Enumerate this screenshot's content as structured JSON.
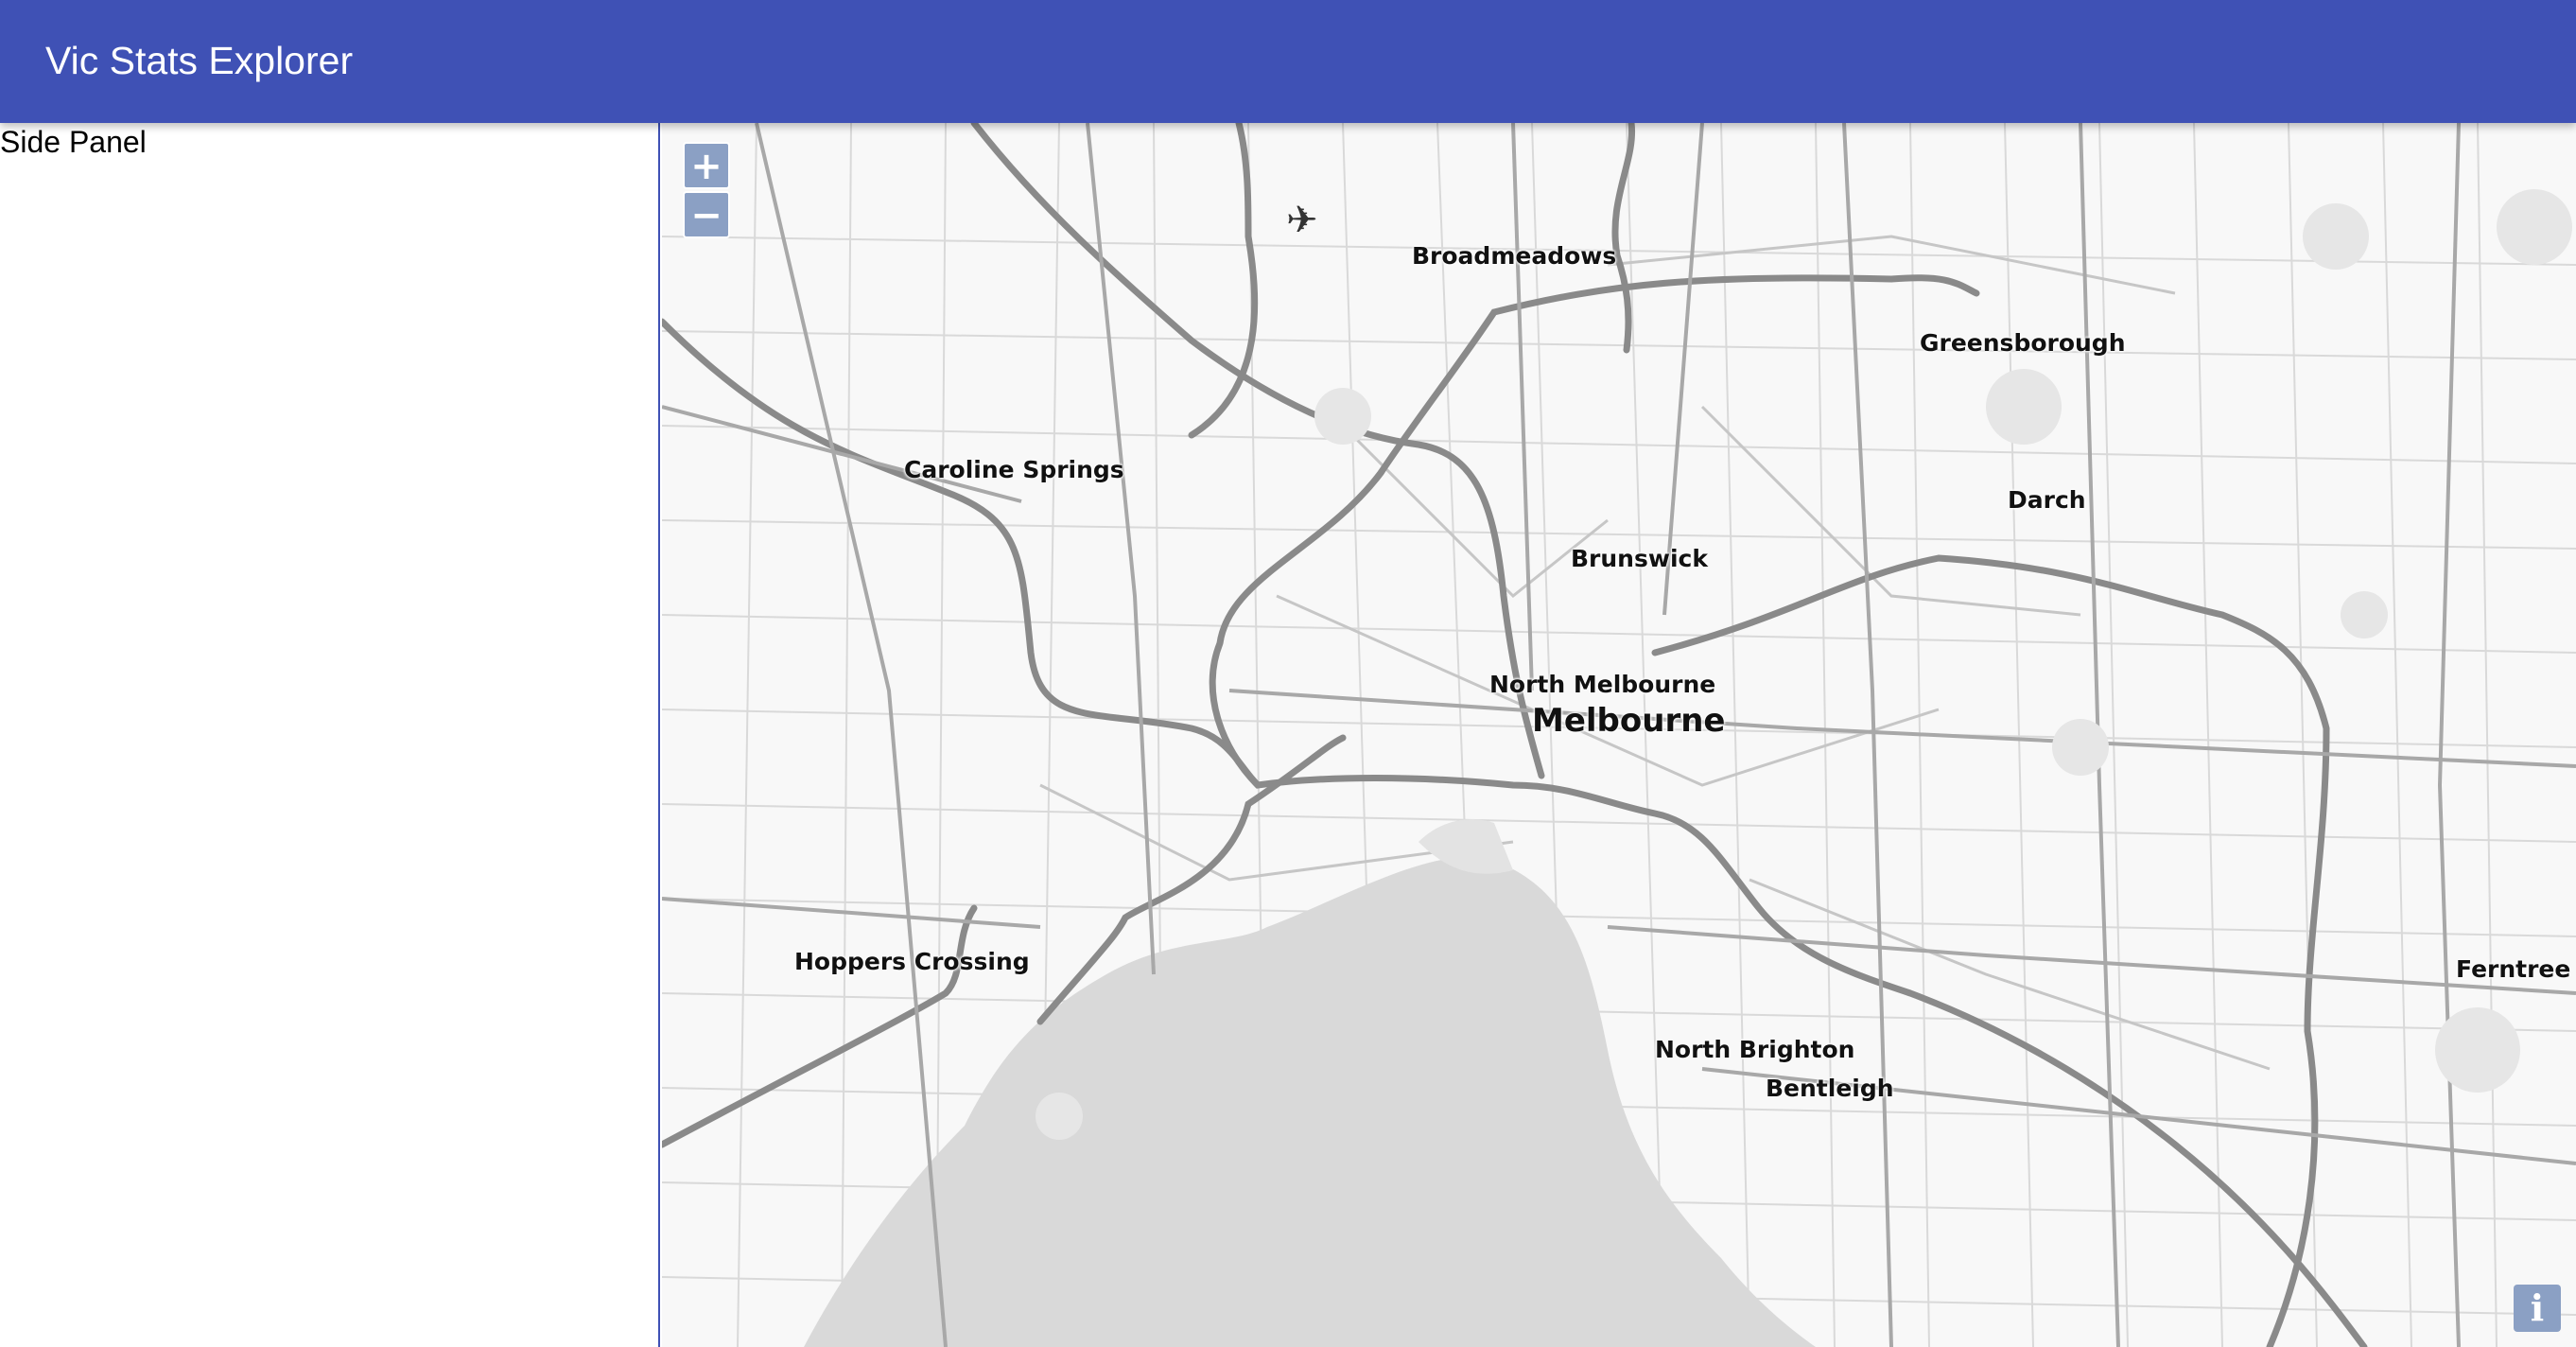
{
  "header": {
    "title": "Vic Stats Explorer"
  },
  "side_panel": {
    "title": "Side Panel"
  },
  "map": {
    "zoom_in_label": "+",
    "zoom_out_label": "−",
    "info_label": "i",
    "places": [
      {
        "name": "Broadmeadows"
      },
      {
        "name": "Greensborough"
      },
      {
        "name": "Caroline Springs"
      },
      {
        "name": "Darch"
      },
      {
        "name": "Brunswick"
      },
      {
        "name": "North Melbourne"
      },
      {
        "name": "Melbourne"
      },
      {
        "name": "Hoppers Crossing"
      },
      {
        "name": "North Brighton"
      },
      {
        "name": "Bentleigh"
      },
      {
        "name": "Ferntree G"
      }
    ]
  }
}
